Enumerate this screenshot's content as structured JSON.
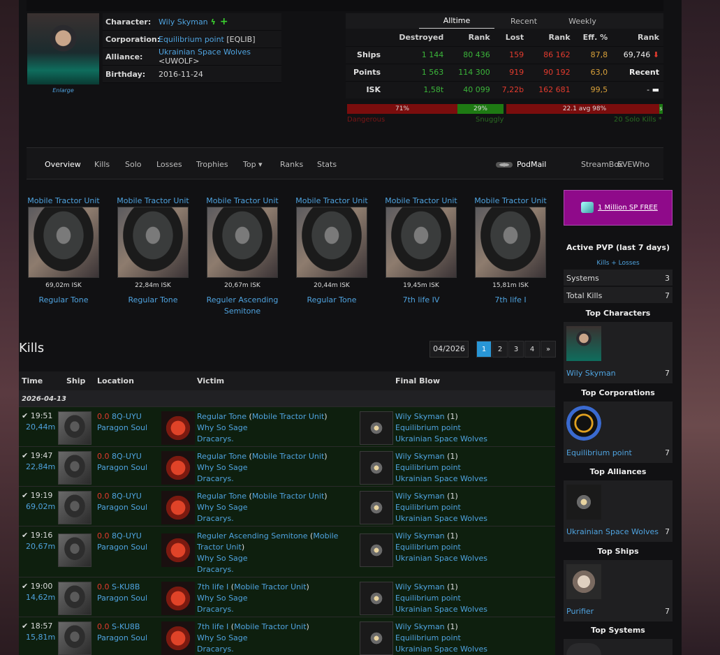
{
  "profile": {
    "character_label": "Character:",
    "character": "Wily Skyman",
    "corporation_label": "Corporation:",
    "corporation": "Equilibrium point",
    "corp_ticker": "[EQLIB]",
    "alliance_label": "Alliance:",
    "alliance": "Ukrainian Space Wolves",
    "alliance_ticker": "<UWOLF>",
    "birthday_label": "Birthday:",
    "birthday": "2016-11-24",
    "enlarge": "Enlarge"
  },
  "stats": {
    "tabs": [
      "Alltime",
      "Recent",
      "Weekly"
    ],
    "active_tab": "Alltime",
    "headers": [
      "Destroyed",
      "Rank",
      "Lost",
      "Rank",
      "Eff. %",
      "Rank"
    ],
    "rows": [
      {
        "label": "Ships",
        "destroyed": "1 144",
        "rank1": "80 436",
        "lost": "159",
        "rank2": "86 162",
        "eff": "87,8",
        "rank3": "69,746"
      },
      {
        "label": "Points",
        "destroyed": "1 563",
        "rank1": "114 300",
        "lost": "919",
        "rank2": "90 192",
        "eff": "63,0",
        "rank3": "Recent"
      },
      {
        "label": "ISK",
        "destroyed": "1,58t",
        "rank1": "40 099",
        "lost": "7,22b",
        "rank2": "162 681",
        "eff": "99,5",
        "rank3": "- ▬"
      }
    ],
    "bar_dangerous_pct": "71%",
    "bar_snuggly_pct": "29%",
    "bar_avg": "22.1 avg 98%",
    "bar_tail": "s",
    "label_dangerous": "Dangerous",
    "label_snuggly": "Snuggly",
    "label_solo": "20 Solo Kills *"
  },
  "nav": {
    "items": [
      "Overview",
      "Kills",
      "Solo",
      "Losses",
      "Trophies",
      "Top ▾",
      "Ranks",
      "Stats"
    ],
    "right": [
      "PodMail",
      "StreamBox",
      "EVEWho"
    ]
  },
  "top_kills": [
    {
      "ship": "Mobile Tractor Unit",
      "isk": "69,02m ISK",
      "victim": "Regular Tone"
    },
    {
      "ship": "Mobile Tractor Unit",
      "isk": "22,84m ISK",
      "victim": "Regular Tone"
    },
    {
      "ship": "Mobile Tractor Unit",
      "isk": "20,67m ISK",
      "victim": "Reguler Ascending Semitone"
    },
    {
      "ship": "Mobile Tractor Unit",
      "isk": "20,44m ISK",
      "victim": "Regular Tone"
    },
    {
      "ship": "Mobile Tractor Unit",
      "isk": "19,45m ISK",
      "victim": "7th life IV"
    },
    {
      "ship": "Mobile Tractor Unit",
      "isk": "15,81m ISK",
      "victim": "7th life I"
    }
  ],
  "kills": {
    "title": "Kills",
    "month": "04/2026",
    "pages": [
      "1",
      "2",
      "3",
      "4",
      "»"
    ],
    "columns": [
      "Time",
      "Ship",
      "Location",
      "Victim",
      "Final Blow"
    ],
    "date": "2026-04-13",
    "rows": [
      {
        "time": "19:51",
        "value": "20,44m",
        "sec": "0.0",
        "system": "8Q-UYU",
        "region": "Paragon Soul",
        "victim": "Regular Tone",
        "vship": "Mobile Tractor Unit",
        "vcorp": "Why So Sage",
        "valliance": "Dracarys.",
        "fb": "Wily Skyman",
        "fbcount": "(1)",
        "fbcorp": "Equilibrium point",
        "fballiance": "Ukrainian Space Wolves"
      },
      {
        "time": "19:47",
        "value": "22,84m",
        "sec": "0.0",
        "system": "8Q-UYU",
        "region": "Paragon Soul",
        "victim": "Regular Tone",
        "vship": "Mobile Tractor Unit",
        "vcorp": "Why So Sage",
        "valliance": "Dracarys.",
        "fb": "Wily Skyman",
        "fbcount": "(1)",
        "fbcorp": "Equilibrium point",
        "fballiance": "Ukrainian Space Wolves"
      },
      {
        "time": "19:19",
        "value": "69,02m",
        "sec": "0.0",
        "system": "8Q-UYU",
        "region": "Paragon Soul",
        "victim": "Regular Tone",
        "vship": "Mobile Tractor Unit",
        "vcorp": "Why So Sage",
        "valliance": "Dracarys.",
        "fb": "Wily Skyman",
        "fbcount": "(1)",
        "fbcorp": "Equilibrium point",
        "fballiance": "Ukrainian Space Wolves"
      },
      {
        "time": "19:16",
        "value": "20,67m",
        "sec": "0.0",
        "system": "8Q-UYU",
        "region": "Paragon Soul",
        "victim": "Reguler Ascending Semitone",
        "vship": "Mobile Tractor Unit",
        "vcorp": "Why So Sage",
        "valliance": "Dracarys.",
        "fb": "Wily Skyman",
        "fbcount": "(1)",
        "fbcorp": "Equilibrium point",
        "fballiance": "Ukrainian Space Wolves"
      },
      {
        "time": "19:00",
        "value": "14,62m",
        "sec": "0.0",
        "system": "S-KU8B",
        "region": "Paragon Soul",
        "victim": "7th life I",
        "vship": "Mobile Tractor Unit",
        "vcorp": "Why So Sage",
        "valliance": "Dracarys.",
        "fb": "Wily Skyman",
        "fbcount": "(1)",
        "fbcorp": "Equilibrium point",
        "fballiance": "Ukrainian Space Wolves"
      },
      {
        "time": "18:57",
        "value": "15,81m",
        "sec": "0.0",
        "system": "S-KU8B",
        "region": "Paragon Soul",
        "victim": "7th life I",
        "vship": "Mobile Tractor Unit",
        "vcorp": "Why So Sage",
        "valliance": "Dracarys.",
        "fb": "Wily Skyman",
        "fbcount": "(1)",
        "fbcorp": "Equilibrium point",
        "fballiance": "Ukrainian Space Wolves"
      }
    ]
  },
  "sidebar": {
    "promo": "1 Million SP FREE",
    "active_pvp_title": "Active PVP (last 7 days)",
    "active_pvp_sub": "Kills + Losses",
    "systems_label": "Systems",
    "systems_value": "3",
    "total_kills_label": "Total Kills",
    "total_kills_value": "7",
    "top_characters": "Top Characters",
    "top_char_name": "Wily Skyman",
    "top_char_count": "7",
    "top_corporations": "Top Corporations",
    "top_corp_name": "Equilibrium point",
    "top_corp_count": "7",
    "top_alliances": "Top Alliances",
    "top_alliance_name": "Ukrainian Space Wolves",
    "top_alliance_count": "7",
    "top_ships": "Top Ships",
    "top_ship_name": "Purifier",
    "top_ship_count": "7",
    "top_systems": "Top Systems"
  }
}
